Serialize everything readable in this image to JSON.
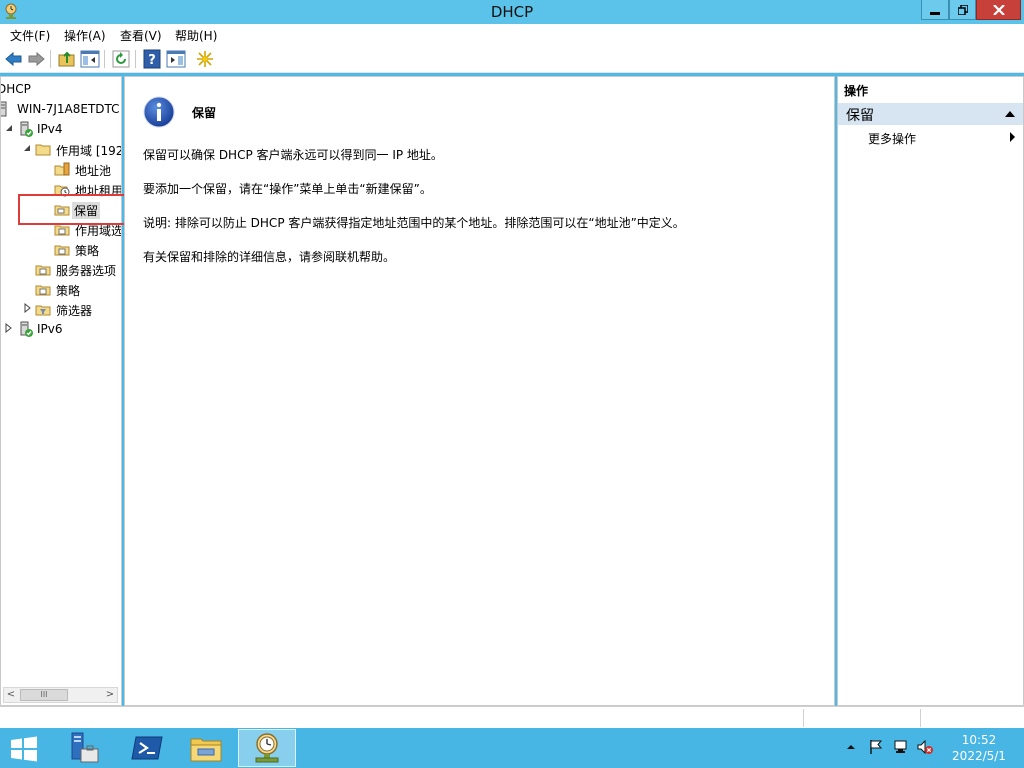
{
  "window": {
    "title": "DHCP"
  },
  "menu": {
    "file": "文件(F)",
    "action": "操作(A)",
    "view": "查看(V)",
    "help": "帮助(H)"
  },
  "tree": {
    "root": "DHCP",
    "server": "WIN-7J1A8ETDTC",
    "ipv4": "IPv4",
    "scope": "作用域 [192",
    "address_pool": "地址池",
    "address_leases": "地址租用",
    "reservations": "保留",
    "scope_options": "作用域选",
    "scope_policies": "策略",
    "server_options": "服务器选项",
    "policies": "策略",
    "filters": "筛选器",
    "ipv6": "IPv6"
  },
  "content": {
    "heading": "保留",
    "line1": "保留可以确保 DHCP 客户端永远可以得到同一 IP 地址。",
    "line2": "要添加一个保留，请在“操作”菜单上单击“新建保留”。",
    "line3": "说明: 排除可以防止 DHCP 客户端获得指定地址范围中的某个地址。排除范围可以在“地址池”中定义。",
    "line4": "有关保留和排除的详细信息，请参阅联机帮助。"
  },
  "actions": {
    "header": "操作",
    "section": "保留",
    "more": "更多操作"
  },
  "clock": {
    "time": "10:52",
    "date": "2022/5/1"
  },
  "colors": {
    "titlebar": "#5bc3ea",
    "taskbar": "#47b6e4",
    "selection": "#d7e4f1",
    "highlight": "#e03b3b"
  }
}
